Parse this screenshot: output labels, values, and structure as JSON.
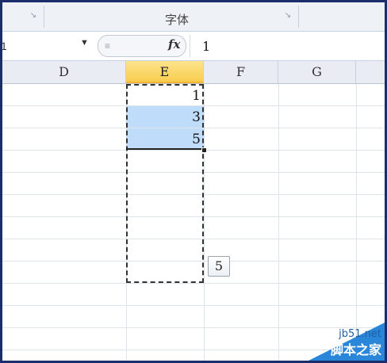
{
  "ribbon": {
    "group_label": "字体"
  },
  "formula_bar": {
    "name_box": "1",
    "fx_label": "fx",
    "formula_value": "1"
  },
  "columns": [
    {
      "label": "D",
      "selected": false
    },
    {
      "label": "E",
      "selected": true
    },
    {
      "label": "F",
      "selected": false
    },
    {
      "label": "G",
      "selected": false
    }
  ],
  "cells": {
    "e1": "1",
    "e2": "3",
    "e3": "5"
  },
  "autofill_tooltip": "5",
  "watermark": {
    "url": "jb51.net",
    "name": "脚本之家"
  }
}
